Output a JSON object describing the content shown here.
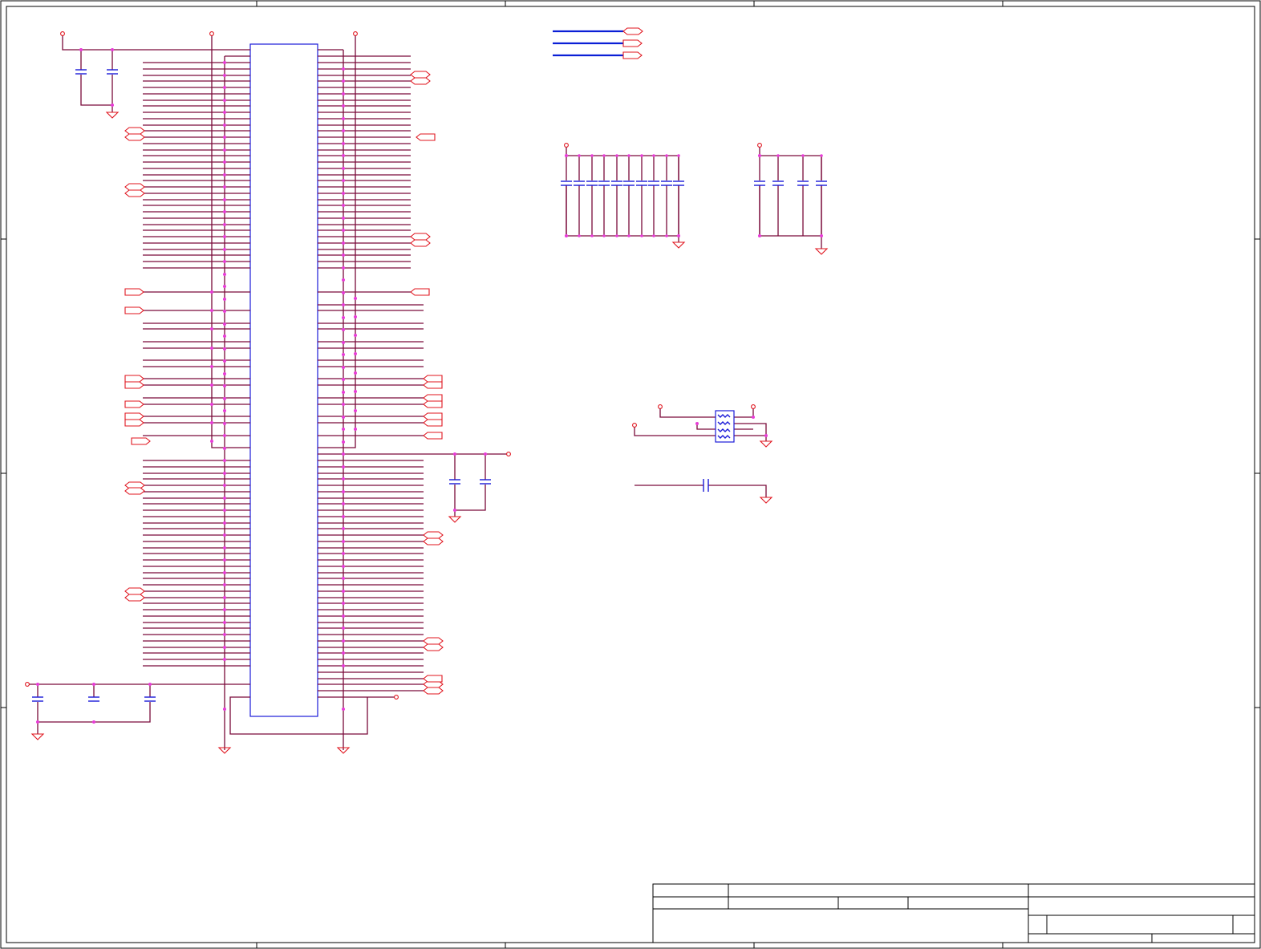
{
  "sheet": {
    "background": "#ffffff",
    "colors": {
      "wire": "#7a0a3a",
      "bus": "#0a1fd6",
      "component": "#1a1ad8",
      "port": "#e0141e",
      "junction": "#e83cd8",
      "frame": "#000000"
    }
  },
  "title_block": {
    "title": "",
    "size": "",
    "document_number": "",
    "revision": "",
    "date": "",
    "sheet": ""
  }
}
